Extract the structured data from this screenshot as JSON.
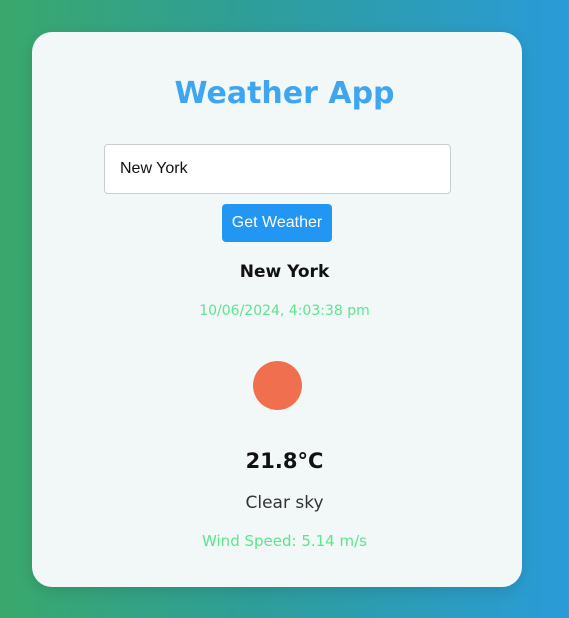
{
  "app": {
    "title": "Weather App"
  },
  "search": {
    "value": "New York",
    "button_label": "Get Weather"
  },
  "weather": {
    "city": "New York",
    "datetime": "10/06/2024, 4:03:38 pm",
    "icon": "sun-icon",
    "icon_color": "#ef6f4e",
    "temperature": "21.8°C",
    "description": "Clear sky",
    "wind": "Wind Speed: 5.14 m/s"
  },
  "colors": {
    "title": "#3ea6f0",
    "button": "#2196f3",
    "accent_green": "#5ee48d"
  }
}
